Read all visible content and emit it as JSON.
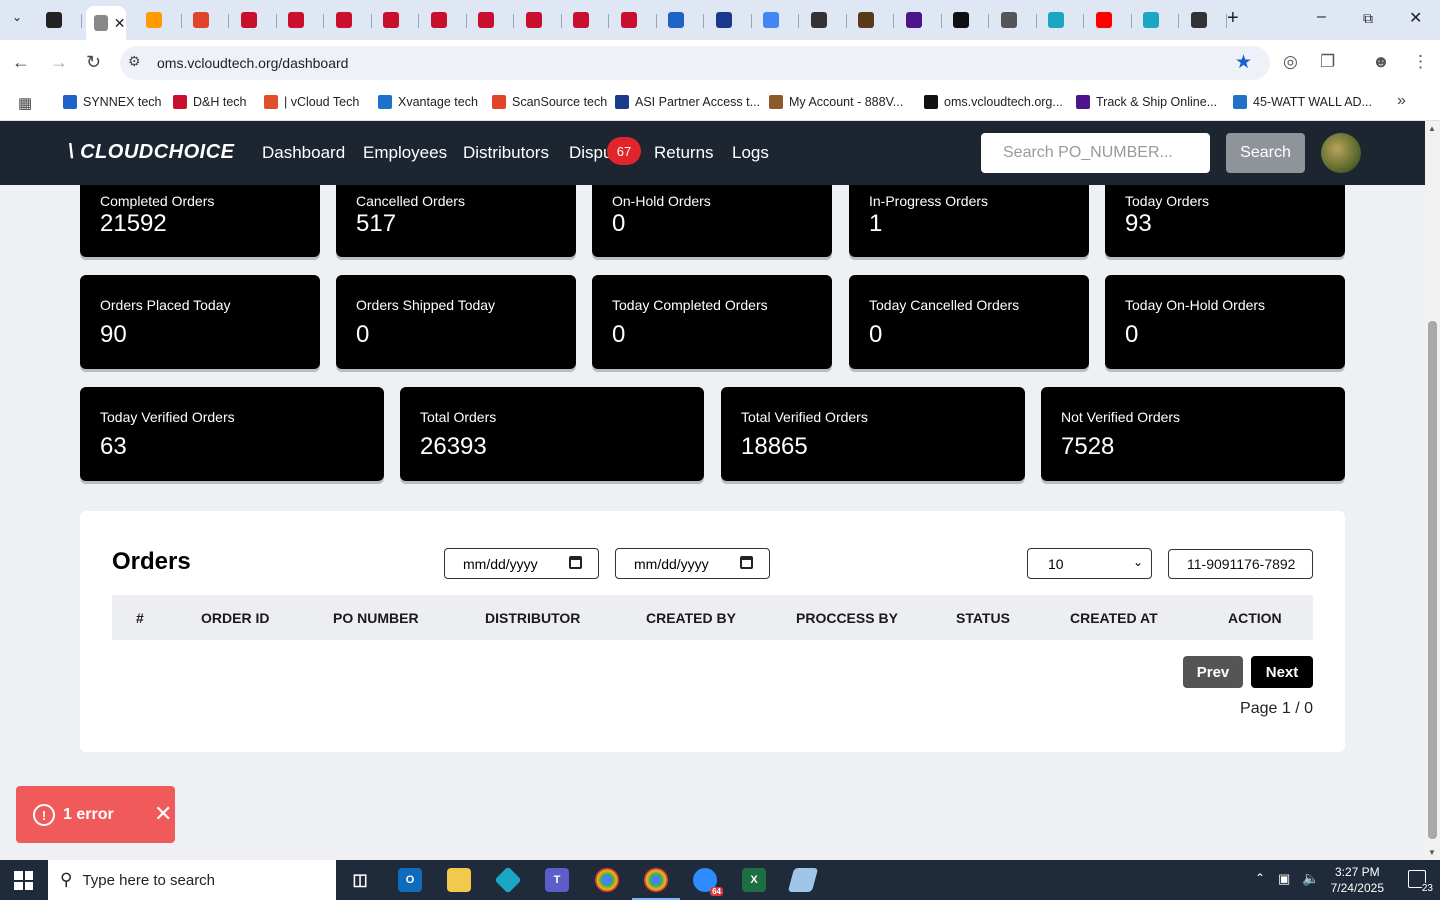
{
  "browser": {
    "url": "oms.vcloudtech.org/dashboard",
    "bookmarks": [
      {
        "label": "SYNNEX tech",
        "color": "#1e63c8"
      },
      {
        "label": "D&H tech",
        "color": "#c8102e"
      },
      {
        "label": "| vCloud Tech",
        "color": "#e14e2b"
      },
      {
        "label": "Xvantage tech",
        "color": "#1b72c9"
      },
      {
        "label": "ScanSource tech",
        "color": "#e0442a"
      },
      {
        "label": "ASI Partner Access t...",
        "color": "#1a3a8c"
      },
      {
        "label": "My Account - 888V...",
        "color": "#8a5a2a"
      },
      {
        "label": "oms.vcloudtech.org...",
        "color": "#111111"
      },
      {
        "label": "Track & Ship Online...",
        "color": "#4d148c"
      },
      {
        "label": "45-WATT WALL AD...",
        "color": "#1f74c7"
      }
    ],
    "tabs": [
      {
        "icon": "amazon-icon",
        "color": "#222222"
      },
      {
        "icon": "active-tab-icon",
        "color": "#888888"
      },
      {
        "icon": "amazon-icon",
        "color": "#ff9900"
      },
      {
        "icon": "scansource-icon",
        "color": "#e0442a"
      },
      {
        "icon": "dh-icon",
        "color": "#c8102e"
      },
      {
        "icon": "dh-icon",
        "color": "#c8102e"
      },
      {
        "icon": "dh-icon",
        "color": "#c8102e"
      },
      {
        "icon": "dh-icon",
        "color": "#c8102e"
      },
      {
        "icon": "dh-icon",
        "color": "#c8102e"
      },
      {
        "icon": "dh-icon",
        "color": "#c8102e"
      },
      {
        "icon": "dh-icon",
        "color": "#c8102e"
      },
      {
        "icon": "dh-icon",
        "color": "#c8102e"
      },
      {
        "icon": "dh-icon",
        "color": "#c8102e"
      },
      {
        "icon": "synnex-icon",
        "color": "#1e63c8"
      },
      {
        "icon": "asi-icon",
        "color": "#1a3a8c"
      },
      {
        "icon": "google-icon",
        "color": "#4285f4"
      },
      {
        "icon": "amazon-icon",
        "color": "#333333"
      },
      {
        "icon": "ups-icon",
        "color": "#5a3a1a"
      },
      {
        "icon": "fedex-icon",
        "color": "#4d148c"
      },
      {
        "icon": "openai-icon",
        "color": "#111111"
      },
      {
        "icon": "cars-icon",
        "color": "#555555"
      },
      {
        "icon": "extension-icon",
        "color": "#1aa7c4"
      },
      {
        "icon": "youtube-icon",
        "color": "#ff0000"
      },
      {
        "icon": "extension-icon",
        "color": "#1aa7c4"
      },
      {
        "icon": "media-icon",
        "color": "#333333"
      }
    ]
  },
  "app": {
    "logo": "\\ CLOUDCHOICE",
    "nav": [
      {
        "label": "Dashboard"
      },
      {
        "label": "Employees"
      },
      {
        "label": "Distributors"
      },
      {
        "label": "Dispu"
      },
      {
        "label": "Returns"
      },
      {
        "label": "Logs"
      }
    ],
    "disputes_badge": "67",
    "search_placeholder": "Search PO_NUMBER...",
    "search_button": "Search"
  },
  "stats": {
    "row1": [
      {
        "label": "Completed Orders",
        "value": "21592"
      },
      {
        "label": "Cancelled Orders",
        "value": "517"
      },
      {
        "label": "On-Hold Orders",
        "value": "0"
      },
      {
        "label": "In-Progress Orders",
        "value": "1"
      },
      {
        "label": "Today Orders",
        "value": "93"
      }
    ],
    "row2": [
      {
        "label": "Orders Placed Today",
        "value": "90"
      },
      {
        "label": "Orders Shipped Today",
        "value": "0"
      },
      {
        "label": "Today Completed Orders",
        "value": "0"
      },
      {
        "label": "Today Cancelled Orders",
        "value": "0"
      },
      {
        "label": "Today On-Hold Orders",
        "value": "0"
      }
    ],
    "row3": [
      {
        "label": "Today Verified Orders",
        "value": "63"
      },
      {
        "label": "Total Orders",
        "value": "26393"
      },
      {
        "label": "Total Verified Orders",
        "value": "18865"
      },
      {
        "label": "Not Verified Orders",
        "value": "7528"
      }
    ]
  },
  "orders": {
    "title": "Orders",
    "date_from_placeholder": "mm/dd/yyyy",
    "date_to_placeholder": "mm/dd/yyyy",
    "per_page": "10",
    "po_search_value": "11-9091176-7892",
    "columns": [
      "#",
      "ORDER ID",
      "PO NUMBER",
      "DISTRIBUTOR",
      "CREATED BY",
      "PROCCESS BY",
      "STATUS",
      "CREATED AT",
      "ACTION"
    ],
    "prev_label": "Prev",
    "next_label": "Next",
    "page_info": "Page 1 / 0"
  },
  "toast": {
    "message": "1 error",
    "color": "#f05a5a"
  },
  "taskbar": {
    "search_placeholder": "Type here to search",
    "time": "3:27 PM",
    "date": "7/24/2025",
    "notifications": "23",
    "zoom_badge": "64"
  }
}
